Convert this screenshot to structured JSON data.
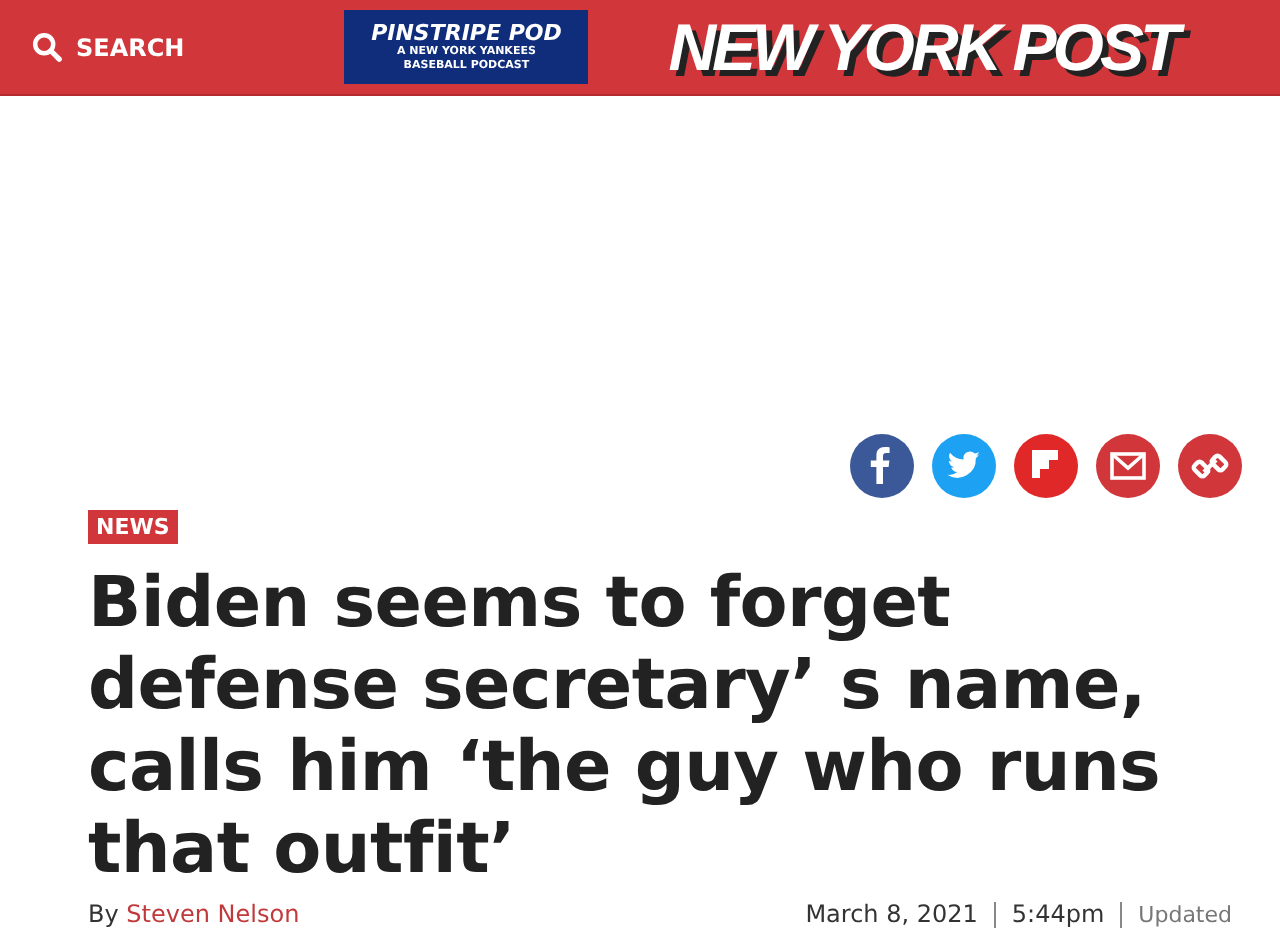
{
  "header": {
    "search_label": "SEARCH",
    "ad": {
      "title": "PINSTRIPE POD",
      "subtitle_lines": [
        "A NEW YORK YANKEES",
        "BASEBALL PODCAST"
      ]
    },
    "logo": "NEW YORK POST"
  },
  "share_buttons": [
    {
      "kind": "facebook"
    },
    {
      "kind": "twitter"
    },
    {
      "kind": "flipboard"
    },
    {
      "kind": "email"
    },
    {
      "kind": "link"
    }
  ],
  "article": {
    "section_tag": "NEWS",
    "headline_lines": [
      "Biden seems to forget",
      "defense secretary’ s name,",
      "calls him  ‘the guy who runs",
      "that outfit’"
    ],
    "byline_prefix": "By",
    "author": "Steven Nelson",
    "date": "March 8, 2021",
    "time": "5:44pm",
    "updated_label": "Updated"
  }
}
